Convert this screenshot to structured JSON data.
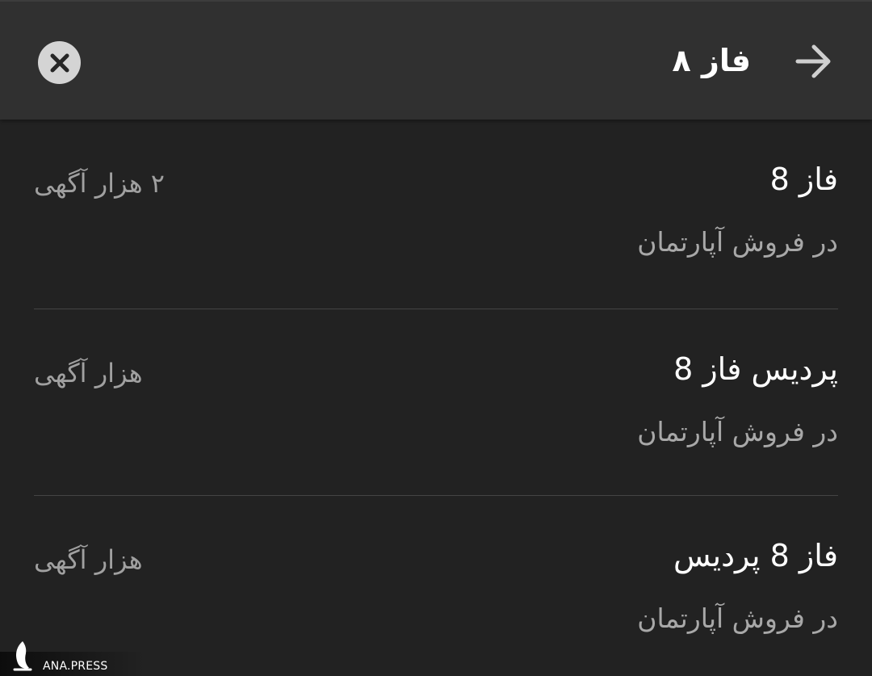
{
  "header": {
    "search_value": "فاز ۸",
    "back_icon": "arrow-right-icon",
    "clear_icon": "close-circle-icon"
  },
  "results": [
    {
      "title": "فاز 8",
      "subtitle": "در فروش آپارتمان",
      "count": "۲ هزار آگهی"
    },
    {
      "title": "پردیس فاز 8",
      "subtitle": "در فروش آپارتمان",
      "count": "هزار آگهی"
    },
    {
      "title": "فاز 8 پردیس",
      "subtitle": "در فروش آپارتمان",
      "count": "هزار آگهی"
    }
  ],
  "watermark": {
    "text": "ANA.PRESS"
  }
}
